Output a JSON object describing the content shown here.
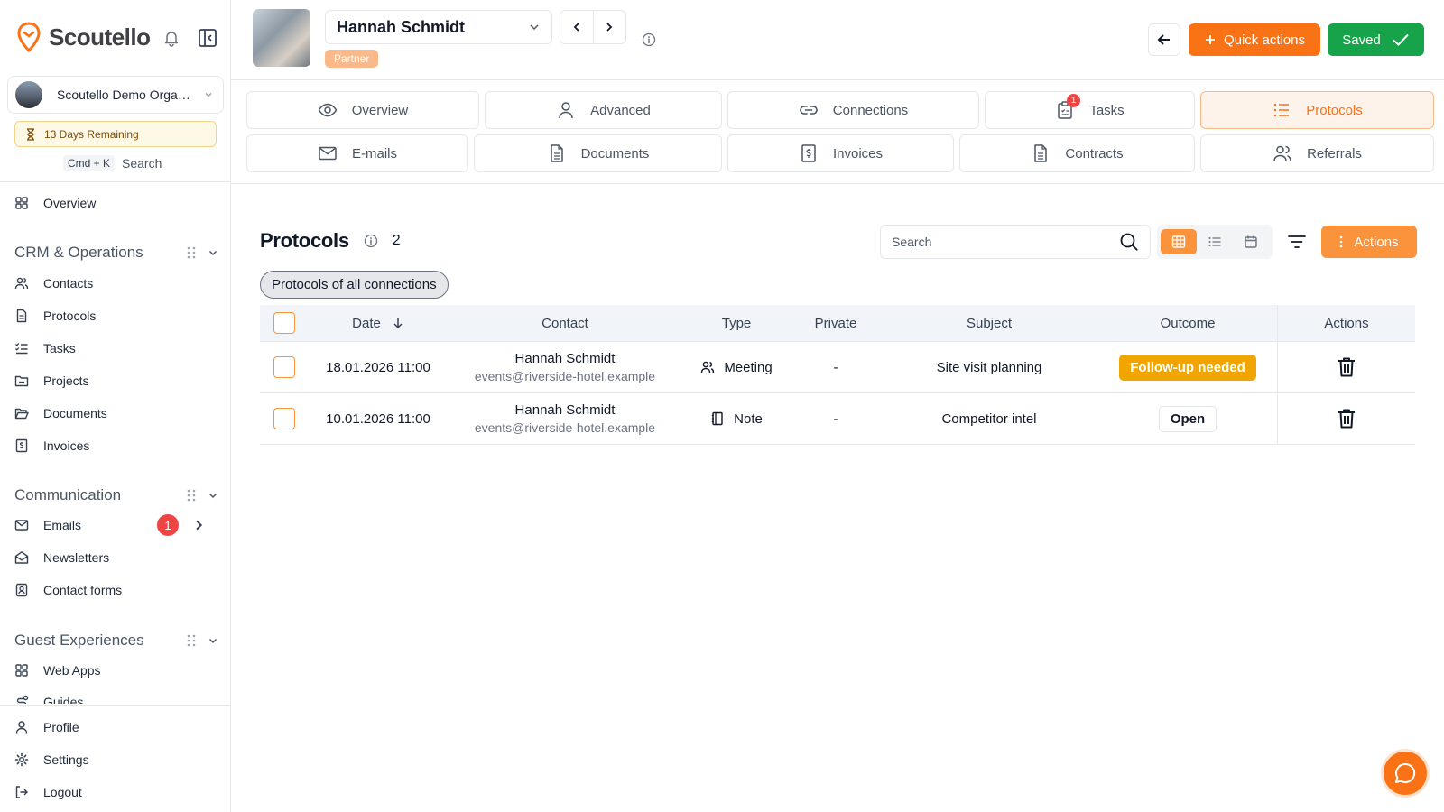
{
  "brand": {
    "name": "Scoutello"
  },
  "org": {
    "name": "Scoutello Demo Organization"
  },
  "trial": {
    "text": "13 Days Remaining"
  },
  "search_hint": {
    "shortcut": "Cmd + K",
    "label": "Search"
  },
  "sidebar": {
    "top": [
      {
        "label": "Overview",
        "icon": "grid-icon"
      }
    ],
    "sections": [
      {
        "title": "CRM & Operations",
        "items": [
          {
            "label": "Contacts",
            "icon": "users-icon"
          },
          {
            "label": "Protocols",
            "icon": "document-icon"
          },
          {
            "label": "Tasks",
            "icon": "checklist-icon"
          },
          {
            "label": "Projects",
            "icon": "folder-icon"
          },
          {
            "label": "Documents",
            "icon": "folder-open-icon"
          },
          {
            "label": "Invoices",
            "icon": "invoice-icon"
          }
        ]
      },
      {
        "title": "Communication",
        "items": [
          {
            "label": "Emails",
            "icon": "mail-icon",
            "badge": "1"
          },
          {
            "label": "Newsletters",
            "icon": "mail-open-icon"
          },
          {
            "label": "Contact forms",
            "icon": "contact-form-icon"
          }
        ]
      },
      {
        "title": "Guest Experiences",
        "items": [
          {
            "label": "Web Apps",
            "icon": "grid-icon"
          },
          {
            "label": "Guides",
            "icon": "route-icon"
          }
        ]
      }
    ],
    "bottom": [
      {
        "label": "Profile",
        "icon": "user-icon"
      },
      {
        "label": "Settings",
        "icon": "gear-icon"
      },
      {
        "label": "Logout",
        "icon": "logout-icon"
      }
    ]
  },
  "header": {
    "contact_name": "Hannah Schmidt",
    "badge": "Partner",
    "quick_actions": "Quick actions",
    "saved": "Saved"
  },
  "tabs": {
    "row1": [
      {
        "label": "Overview",
        "icon": "eye-icon"
      },
      {
        "label": "Advanced",
        "icon": "user-icon"
      },
      {
        "label": "Connections",
        "icon": "link-icon"
      },
      {
        "label": "Tasks",
        "icon": "clipboard-icon",
        "badge": "1"
      },
      {
        "label": "Protocols",
        "icon": "list-icon",
        "active": true
      }
    ],
    "row2": [
      {
        "label": "E-mails",
        "icon": "mail-icon"
      },
      {
        "label": "Documents",
        "icon": "document-icon"
      },
      {
        "label": "Invoices",
        "icon": "invoice-icon"
      },
      {
        "label": "Contracts",
        "icon": "document-icon"
      },
      {
        "label": "Referrals",
        "icon": "users-icon"
      }
    ]
  },
  "content": {
    "title": "Protocols",
    "count": "2",
    "search_placeholder": "Search",
    "actions": "Actions",
    "filter_chip": "Protocols of all connections",
    "columns": [
      "Date",
      "Contact",
      "Type",
      "Private",
      "Subject",
      "Outcome",
      "Actions"
    ],
    "rows": [
      {
        "date": "18.01.2026 11:00",
        "contact_name": "Hannah Schmidt",
        "contact_email": "events@riverside-hotel.example",
        "type": "Meeting",
        "type_icon": "users-icon",
        "private": "-",
        "subject": "Site visit planning",
        "outcome": "Follow-up needed",
        "outcome_style": "warning"
      },
      {
        "date": "10.01.2026 11:00",
        "contact_name": "Hannah Schmidt",
        "contact_email": "events@riverside-hotel.example",
        "type": "Note",
        "type_icon": "notebook-icon",
        "private": "-",
        "subject": "Competitor intel",
        "outcome": "Open",
        "outcome_style": "outline"
      }
    ]
  },
  "colors": {
    "accent": "#f97316",
    "success": "#16a34a",
    "danger": "#ef4444",
    "warning": "#f0a500"
  }
}
